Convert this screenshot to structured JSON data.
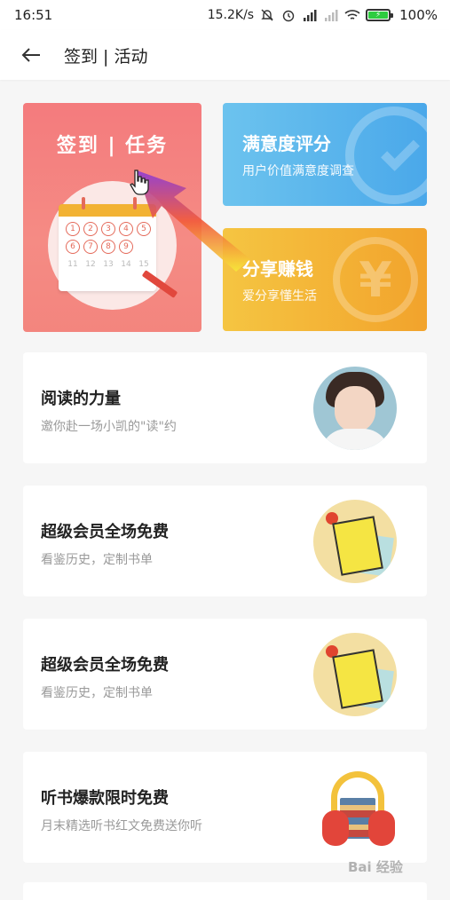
{
  "status_bar": {
    "time": "16:51",
    "network_speed": "15.2K/s",
    "battery": "100%",
    "icons": [
      "mute-icon",
      "alarm-icon",
      "signal-icon",
      "signal-weak-icon",
      "wifi-icon",
      "battery-icon"
    ]
  },
  "header": {
    "title": "签到 | 活动",
    "back_icon": "arrow-left-icon"
  },
  "cards": {
    "signin": {
      "title": "签到 | 任务",
      "calendar_numbers": [
        "1",
        "2",
        "3",
        "4",
        "5",
        "6",
        "7",
        "8",
        "9",
        "",
        "11",
        "12",
        "13",
        "14",
        "15"
      ]
    },
    "rating": {
      "title": "满意度评分",
      "subtitle": "用户价值满意度调查"
    },
    "share": {
      "title": "分享赚钱",
      "subtitle": "爱分享懂生活"
    }
  },
  "list": [
    {
      "title": "阅读的力量",
      "subtitle": "邀你赴一场小凯的\"读\"约"
    },
    {
      "title": "超级会员全场免费",
      "subtitle": "看鉴历史，定制书单"
    },
    {
      "title": "超级会员全场免费",
      "subtitle": "看鉴历史，定制书单"
    },
    {
      "title": "听书爆款限时免费",
      "subtitle": "月末精选听书红文免费送你听"
    }
  ],
  "watermark": "Bai 经验",
  "colors": {
    "signin_card": "#f47b7d",
    "rating_card": "#4aa8ea",
    "share_card": "#f2a32c",
    "background": "#f6f6f6"
  }
}
